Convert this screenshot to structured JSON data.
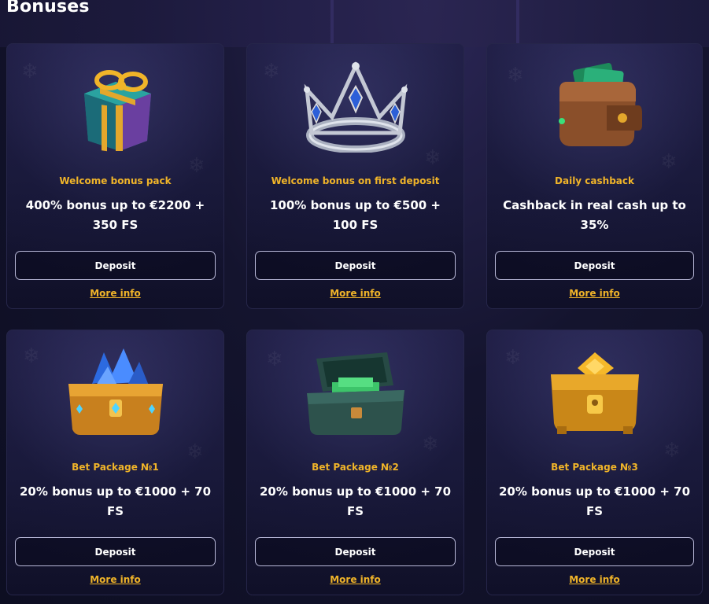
{
  "page": {
    "title": "Bonuses"
  },
  "cards": [
    {
      "icon": "gift-box-icon",
      "subtitle": "Welcome bonus pack",
      "title": "400% bonus up to €2200 + 350 FS",
      "button": "Deposit",
      "link": "More info"
    },
    {
      "icon": "crown-icon",
      "subtitle": "Welcome bonus on first deposit",
      "title": "100% bonus up to €500 + 100 FS",
      "button": "Deposit",
      "link": "More info"
    },
    {
      "icon": "wallet-icon",
      "subtitle": "Daily cashback",
      "title": "Cashback in real cash up to 35%",
      "button": "Deposit",
      "link": "More info"
    },
    {
      "icon": "crystal-chest-icon",
      "subtitle": "Bet Package №1",
      "title": "20% bonus up to €1000 + 70 FS",
      "button": "Deposit",
      "link": "More info"
    },
    {
      "icon": "money-chest-icon",
      "subtitle": "Bet Package №2",
      "title": "20% bonus up to €1000 + 70 FS",
      "button": "Deposit",
      "link": "More info"
    },
    {
      "icon": "gold-chest-icon",
      "subtitle": "Bet Package №3",
      "title": "20% bonus up to €1000 + 70 FS",
      "button": "Deposit",
      "link": "More info"
    }
  ],
  "colors": {
    "accent": "#f0b429",
    "card_bg": "#1a1a3c",
    "page_bg": "#14142e"
  }
}
